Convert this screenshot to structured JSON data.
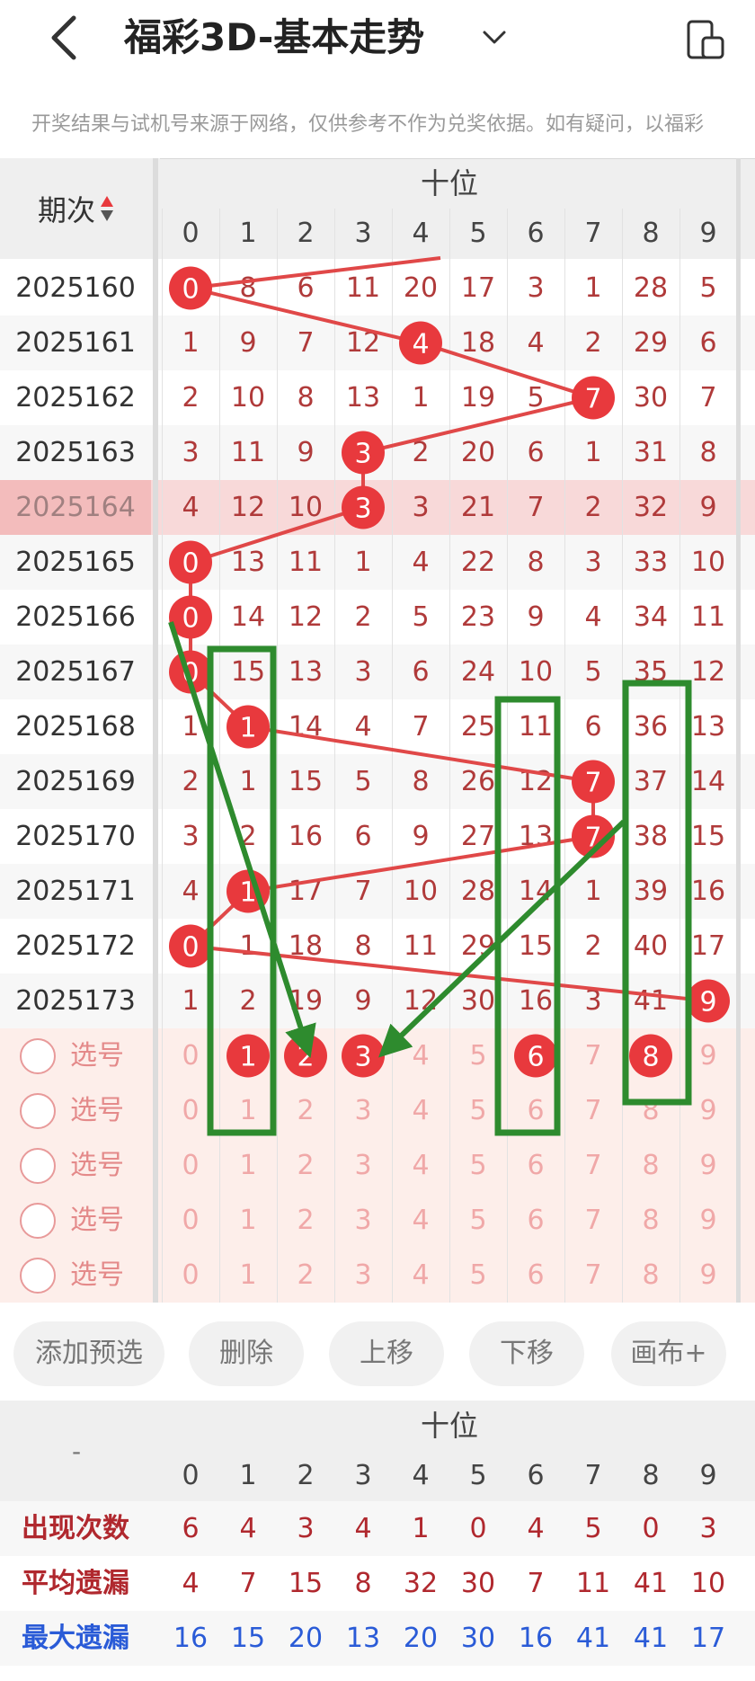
{
  "header": {
    "title": "福彩3D-基本走势",
    "disclaimer": "开奖结果与试机号来源于网络，仅供参考不作为兑奖依据。如有疑问，以福彩"
  },
  "table": {
    "period_label": "期次",
    "group_label": "十位",
    "digits": [
      "0",
      "1",
      "2",
      "3",
      "4",
      "5",
      "6",
      "7",
      "8",
      "9"
    ],
    "rows": [
      {
        "period": "2025160",
        "cells": [
          "0",
          "8",
          "6",
          "11",
          "20",
          "17",
          "3",
          "1",
          "28",
          "5"
        ],
        "hit": 0
      },
      {
        "period": "2025161",
        "cells": [
          "1",
          "9",
          "7",
          "12",
          "4",
          "18",
          "4",
          "2",
          "29",
          "6"
        ],
        "hit": 4
      },
      {
        "period": "2025162",
        "cells": [
          "2",
          "10",
          "8",
          "13",
          "1",
          "19",
          "5",
          "7",
          "30",
          "7"
        ],
        "hit": 7
      },
      {
        "period": "2025163",
        "cells": [
          "3",
          "11",
          "9",
          "3",
          "2",
          "20",
          "6",
          "1",
          "31",
          "8"
        ],
        "hit": 3
      },
      {
        "period": "2025164",
        "cells": [
          "4",
          "12",
          "10",
          "3",
          "3",
          "21",
          "7",
          "2",
          "32",
          "9"
        ],
        "hit": 3,
        "highlight": true
      },
      {
        "period": "2025165",
        "cells": [
          "0",
          "13",
          "11",
          "1",
          "4",
          "22",
          "8",
          "3",
          "33",
          "10"
        ],
        "hit": 0
      },
      {
        "period": "2025166",
        "cells": [
          "0",
          "14",
          "12",
          "2",
          "5",
          "23",
          "9",
          "4",
          "34",
          "11"
        ],
        "hit": 0
      },
      {
        "period": "2025167",
        "cells": [
          "0",
          "15",
          "13",
          "3",
          "6",
          "24",
          "10",
          "5",
          "35",
          "12"
        ],
        "hit": 0
      },
      {
        "period": "2025168",
        "cells": [
          "1",
          "1",
          "14",
          "4",
          "7",
          "25",
          "11",
          "6",
          "36",
          "13"
        ],
        "hit": 1
      },
      {
        "period": "2025169",
        "cells": [
          "2",
          "1",
          "15",
          "5",
          "8",
          "26",
          "12",
          "7",
          "37",
          "14"
        ],
        "hit": 7
      },
      {
        "period": "2025170",
        "cells": [
          "3",
          "2",
          "16",
          "6",
          "9",
          "27",
          "13",
          "7",
          "38",
          "15"
        ],
        "hit": 7
      },
      {
        "period": "2025171",
        "cells": [
          "4",
          "1",
          "17",
          "7",
          "10",
          "28",
          "14",
          "1",
          "39",
          "16"
        ],
        "hit": 1
      },
      {
        "period": "2025172",
        "cells": [
          "0",
          "1",
          "18",
          "8",
          "11",
          "29",
          "15",
          "2",
          "40",
          "17"
        ],
        "hit": 0
      },
      {
        "period": "2025173",
        "cells": [
          "1",
          "2",
          "19",
          "9",
          "12",
          "30",
          "16",
          "3",
          "41",
          "9"
        ],
        "hit": 9
      }
    ]
  },
  "picks": {
    "label": "选号",
    "digits": [
      "0",
      "1",
      "2",
      "3",
      "4",
      "5",
      "6",
      "7",
      "8",
      "9"
    ],
    "selected_first_row": [
      1,
      2,
      3,
      6,
      8
    ]
  },
  "buttons": [
    "添加预选",
    "删除",
    "上移",
    "下移",
    "画布+"
  ],
  "stats": {
    "dash": "-",
    "group_label": "十位",
    "digits": [
      "0",
      "1",
      "2",
      "3",
      "4",
      "5",
      "6",
      "7",
      "8",
      "9"
    ],
    "rows": [
      {
        "label": "出现次数",
        "color": "#b0282e",
        "values": [
          "6",
          "4",
          "3",
          "4",
          "1",
          "0",
          "4",
          "5",
          "0",
          "3"
        ]
      },
      {
        "label": "平均遗漏",
        "color": "#b0282e",
        "values": [
          "4",
          "7",
          "15",
          "8",
          "32",
          "30",
          "7",
          "11",
          "41",
          "10"
        ]
      },
      {
        "label": "最大遗漏",
        "color": "#2a5bd7",
        "values": [
          "16",
          "15",
          "20",
          "13",
          "20",
          "30",
          "16",
          "41",
          "41",
          "17"
        ]
      }
    ]
  },
  "colors": {
    "ball": "#e8393d",
    "trend_line": "#e04848",
    "annotation": "#2e8b2e"
  }
}
